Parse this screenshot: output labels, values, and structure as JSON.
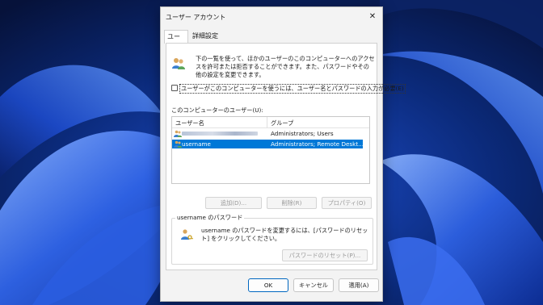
{
  "window": {
    "title": "ユーザー アカウント",
    "close_glyph": "✕"
  },
  "tabs": [
    {
      "label": "ユーザー"
    },
    {
      "label": "詳細設定"
    }
  ],
  "intro_text": "下の一覧を使って、ほかのユーザーのこのコンピューターへのアクセスを許可または拒否することができます。また、パスワードやその他の設定を変更できます。",
  "require_login_checkbox": {
    "label": "ユーザーがこのコンピューターを使うには、ユーザー名とパスワードの入力が必要(E)",
    "checked": false
  },
  "users_list": {
    "label": "このコンピューターのユーザー(U):",
    "columns": [
      "ユーザー名",
      "グループ"
    ],
    "rows": [
      {
        "name": "",
        "groups": "Administrators; Users",
        "selected": false
      },
      {
        "name": "username",
        "groups": "Administrators; Remote Deskt...",
        "selected": true
      }
    ]
  },
  "list_buttons": {
    "add": "追加(D)...",
    "remove": "削除(R)",
    "properties": "プロパティ(O)"
  },
  "password_group": {
    "title": "username のパスワード",
    "text": "username のパスワードを変更するには、[パスワードのリセット] をクリックしてください。",
    "reset_button": "パスワードのリセット(P)..."
  },
  "footer": {
    "ok": "OK",
    "cancel": "キャンセル",
    "apply": "適用(A)"
  },
  "colors": {
    "selection": "#0078d7",
    "wallpaper": "#0a1a4a",
    "dialog_bg": "#f3f3f3"
  }
}
